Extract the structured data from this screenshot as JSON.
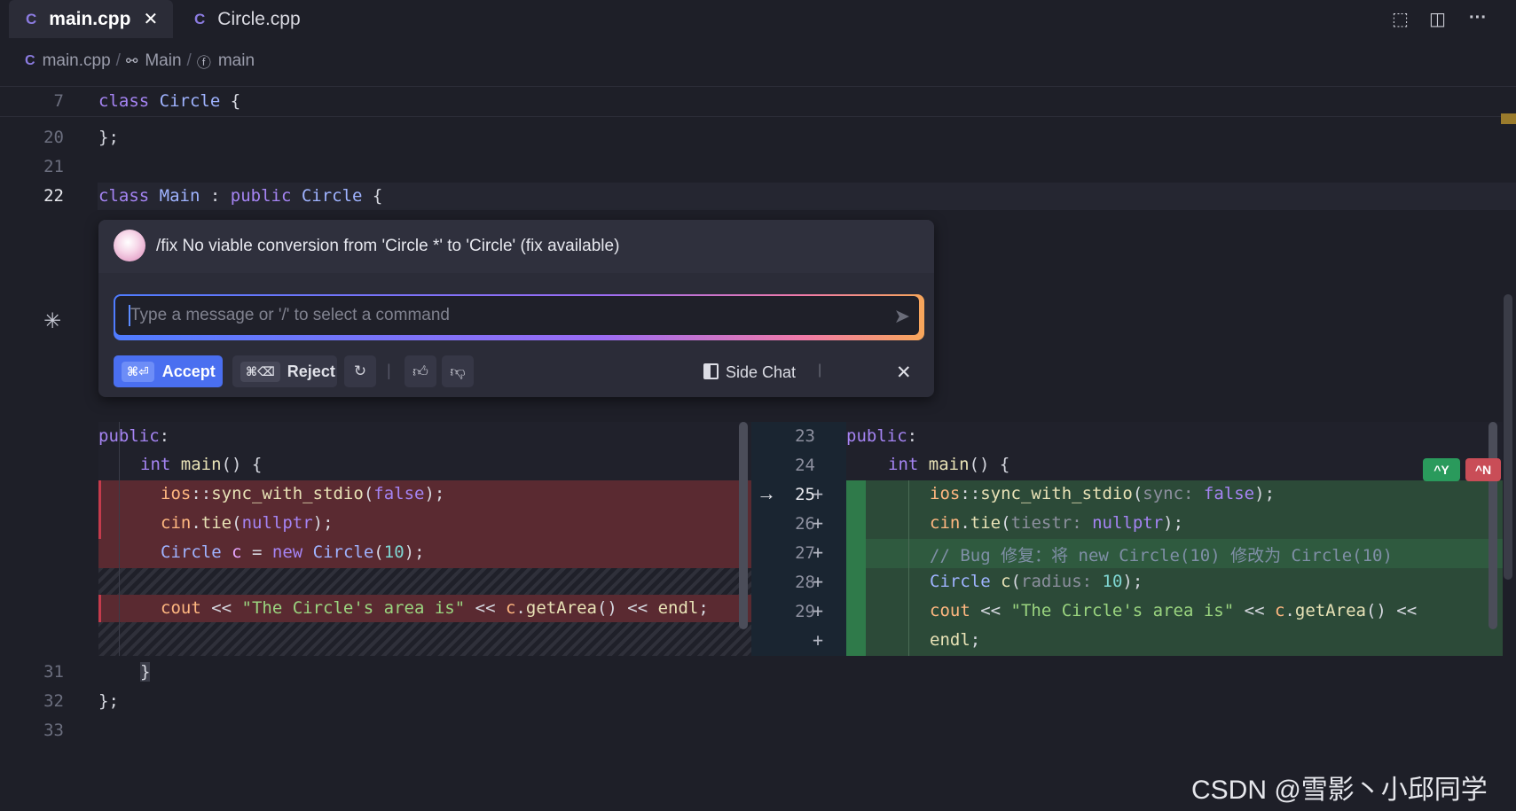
{
  "tabs": [
    {
      "label": "main.cpp",
      "icon": "cpp-file-icon",
      "active": true
    },
    {
      "label": "Circle.cpp",
      "icon": "cpp-file-icon",
      "active": false
    }
  ],
  "breadcrumb": {
    "file": "main.cpp",
    "class": "Main",
    "func": "main"
  },
  "lines": {
    "l7": {
      "num": "7"
    },
    "l20": {
      "num": "20",
      "text": "};"
    },
    "l21": {
      "num": "21"
    },
    "l22": {
      "num": "22"
    },
    "l31": {
      "num": "31"
    },
    "l32": {
      "num": "32",
      "text": "};"
    },
    "l33": {
      "num": "33"
    }
  },
  "chat": {
    "title": "/fix No viable conversion from 'Circle *' to 'Circle' (fix available)",
    "placeholder": "Type a message or '/' to select a command",
    "accept_kbd": "⌘⏎",
    "accept_label": "Accept",
    "reject_kbd": "⌘⌫",
    "reject_label": "Reject",
    "side_chat_label": "Side Chat",
    "divider": "|"
  },
  "diff": {
    "right_line_numbers": [
      "23",
      "24",
      "25",
      "26",
      "27",
      "28",
      "29"
    ],
    "badge_accept": "^Y",
    "badge_reject": "^N"
  },
  "watermark": "CSDN @雪影丶小邱同学"
}
